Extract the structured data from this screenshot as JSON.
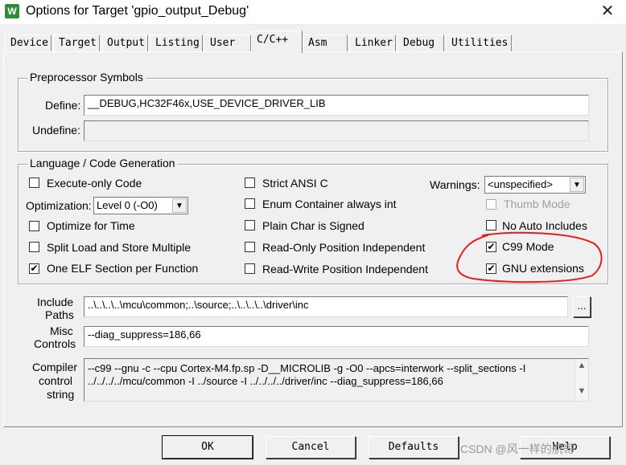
{
  "window": {
    "title": "Options for Target 'gpio_output_Debug'",
    "app_icon": "W",
    "close_glyph": "✕"
  },
  "tabs": [
    {
      "label": "Device"
    },
    {
      "label": "Target"
    },
    {
      "label": "Output"
    },
    {
      "label": "Listing"
    },
    {
      "label": "User"
    },
    {
      "label": "C/C++"
    },
    {
      "label": "Asm"
    },
    {
      "label": "Linker"
    },
    {
      "label": "Debug"
    },
    {
      "label": "Utilities"
    }
  ],
  "active_tab": "C/C++",
  "preprocessor": {
    "group_label": "Preprocessor Symbols",
    "define_label": "Define:",
    "define_value": "__DEBUG,HC32F46x,USE_DEVICE_DRIVER_LIB",
    "undefine_label": "Undefine:",
    "undefine_value": ""
  },
  "language": {
    "group_label": "Language / Code Generation",
    "execute_only": {
      "label": "Execute-only Code",
      "checked": false
    },
    "optimization_label": "Optimization:",
    "optimization_value": "Level 0 (-O0)",
    "optimize_time": {
      "label": "Optimize for Time",
      "checked": false
    },
    "split_load": {
      "label": "Split Load and Store Multiple",
      "checked": false
    },
    "one_elf": {
      "label": "One ELF Section per Function",
      "checked": true
    },
    "strict_ansi": {
      "label": "Strict ANSI C",
      "checked": false
    },
    "enum_int": {
      "label": "Enum Container always int",
      "checked": false
    },
    "plain_char": {
      "label": "Plain Char is Signed",
      "checked": false
    },
    "ro_pos": {
      "label": "Read-Only Position Independent",
      "checked": false
    },
    "rw_pos": {
      "label": "Read-Write Position Independent",
      "checked": false
    },
    "warnings_label": "Warnings:",
    "warnings_value": "<unspecified>",
    "thumb_mode": {
      "label": "Thumb Mode",
      "checked": false,
      "disabled": true
    },
    "no_auto_includes": {
      "label": "No Auto Includes",
      "checked": false
    },
    "c99_mode": {
      "label": "C99 Mode",
      "checked": true
    },
    "gnu_ext": {
      "label": "GNU extensions",
      "checked": true
    },
    "annotation_color": "#e0201c"
  },
  "include_paths": {
    "label_line1": "Include",
    "label_line2": "Paths",
    "value": "..\\..\\..\\..\\mcu\\common;..\\source;..\\..\\..\\..\\driver\\inc",
    "browse_label": "..."
  },
  "misc_controls": {
    "label_line1": "Misc",
    "label_line2": "Controls",
    "value": "--diag_suppress=186,66"
  },
  "compiler_string": {
    "label_line1": "Compiler",
    "label_line2": "control",
    "label_line3": "string",
    "line1": "--c99 --gnu -c --cpu Cortex-M4.fp.sp -D__MICROLIB -g -O0 --apcs=interwork --split_sections -I",
    "line2": "../../../../mcu/common -I ../source -I ../../../../driver/inc --diag_suppress=186,66"
  },
  "buttons": {
    "ok": "OK",
    "cancel": "Cancel",
    "defaults": "Defaults",
    "help": "Help"
  },
  "watermark": "CSDN @风一样的航哥"
}
